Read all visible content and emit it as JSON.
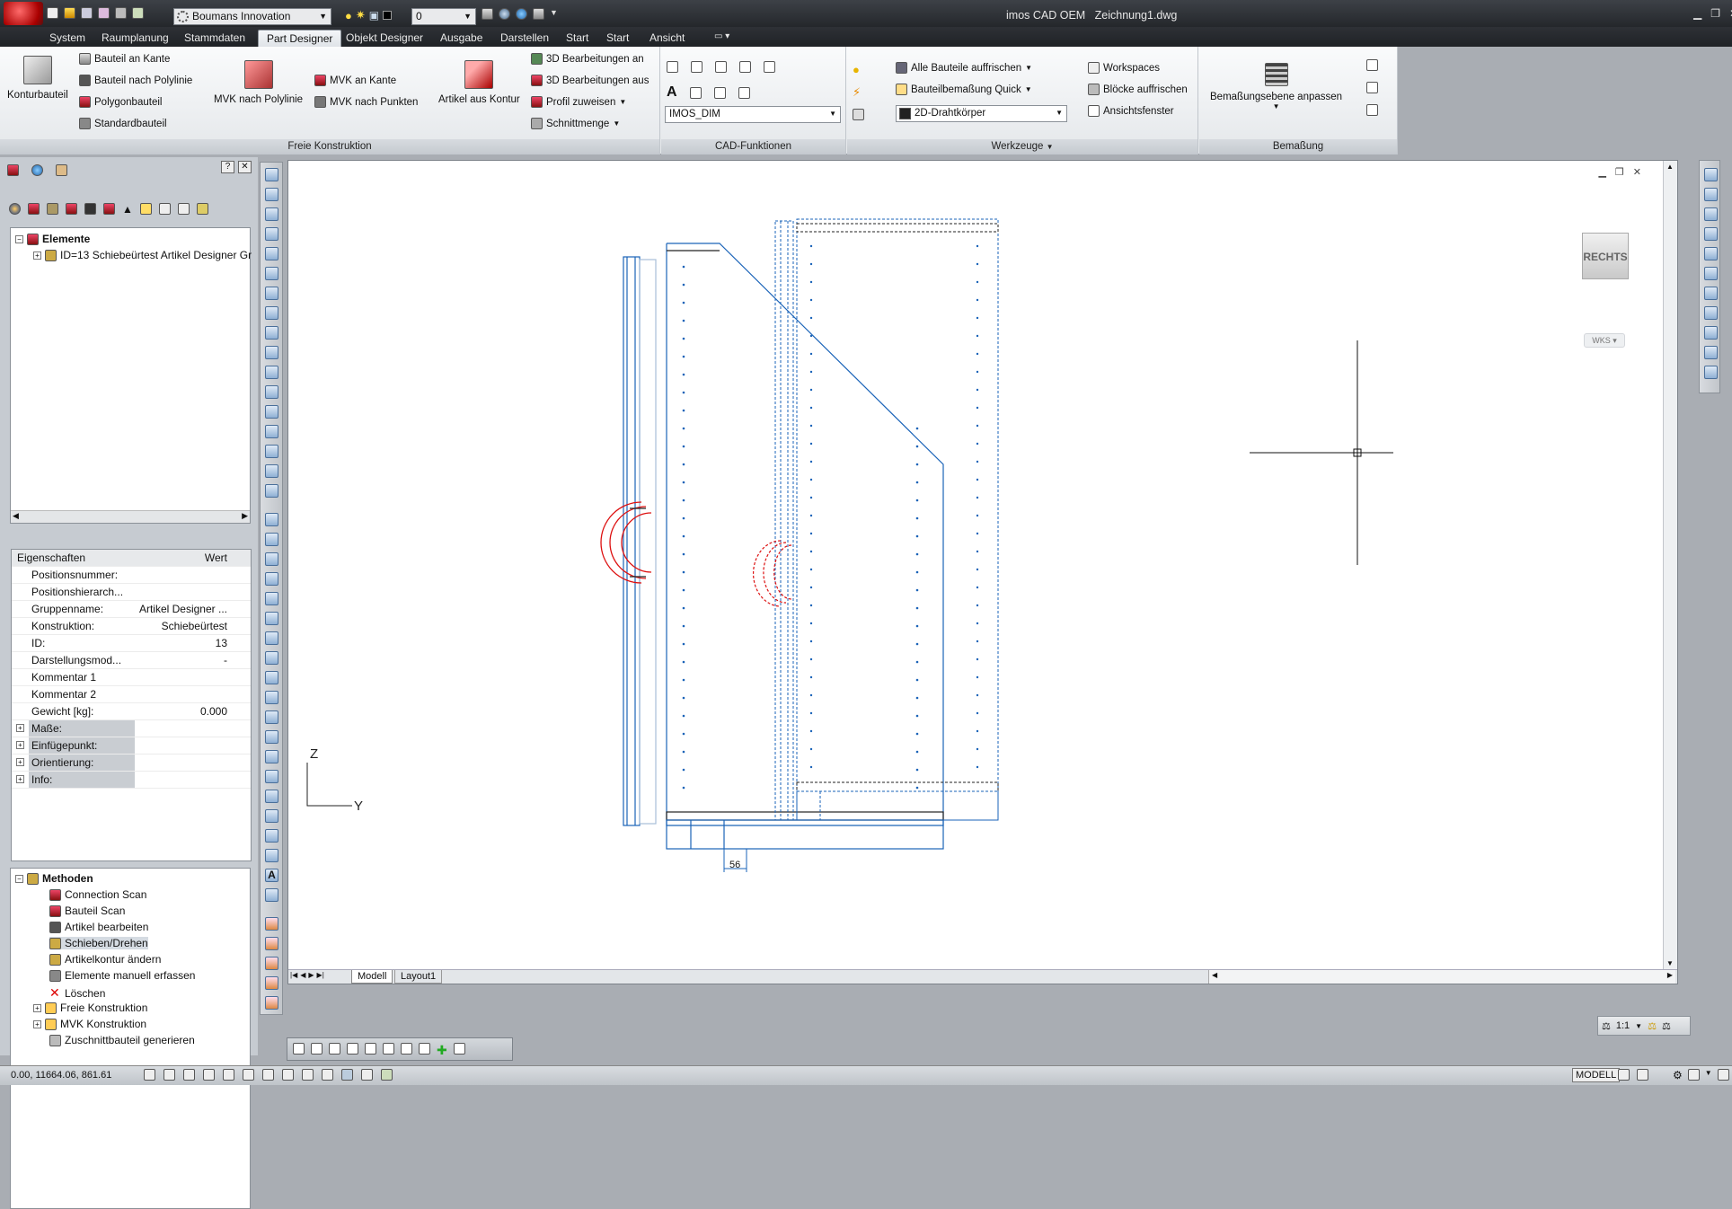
{
  "title_bar": {
    "workspace": "Boumans Innovation",
    "layer": "0",
    "app_title": "imos CAD OEM",
    "document": "Zeichnung1.dwg"
  },
  "menu_tabs": [
    {
      "label": "System"
    },
    {
      "label": "Raumplanung"
    },
    {
      "label": "Stammdaten"
    },
    {
      "label": "Part Designer",
      "active": true
    },
    {
      "label": "Objekt Designer"
    },
    {
      "label": "Ausgabe"
    },
    {
      "label": "Darstellen"
    },
    {
      "label": "Start"
    },
    {
      "label": "Start"
    },
    {
      "label": "Ansicht"
    }
  ],
  "ribbon": {
    "freie": {
      "title": "Freie Konstruktion",
      "konturbauteil": "Konturbauteil",
      "bauteil_kante": "Bauteil an Kante",
      "bauteil_polylinie": "Bauteil nach Polylinie",
      "polygonbauteil": "Polygonbauteil",
      "standardbauteil": "Standardbauteil",
      "mvk_polylinie": "MVK nach Polylinie",
      "mvk_kante": "MVK an Kante",
      "mvk_punkten": "MVK nach Punkten",
      "artikel_kontur": "Artikel aus Kontur",
      "bearb_an": "3D Bearbeitungen an",
      "bearb_aus": "3D Bearbeitungen aus",
      "profil": "Profil zuweisen",
      "schnittmenge": "Schnittmenge"
    },
    "cad": {
      "title": "CAD-Funktionen",
      "dimstyle": "IMOS_DIM"
    },
    "werkzeuge": {
      "title": "Werkzeuge",
      "alle_auffrischen": "Alle Bauteile auffrischen",
      "bemassung_quick": "Bauteilbemaßung Quick",
      "visual_style": "2D-Drahtkörper",
      "workspaces": "Workspaces",
      "bloecke": "Blöcke auffrischen",
      "ansichtsfenster": "Ansichtsfenster"
    },
    "bemassung": {
      "title": "Bemaßung",
      "ebene": "Bemaßungsebene anpassen"
    }
  },
  "elements_tree": {
    "root": "Elemente",
    "item": "ID=13 Schiebeürtest Artikel Designer Gr"
  },
  "properties": {
    "col_name": "Eigenschaften",
    "col_value": "Wert",
    "rows": [
      {
        "name": "Positionsnummer:",
        "value": ""
      },
      {
        "name": "Positionshierarch...",
        "value": ""
      },
      {
        "name": "Gruppenname:",
        "value": "Artikel Designer ..."
      },
      {
        "name": "Konstruktion:",
        "value": "Schiebeürtest"
      },
      {
        "name": "ID:",
        "value": "13"
      },
      {
        "name": "Darstellungsmod...",
        "value": "-"
      },
      {
        "name": "Kommentar 1",
        "value": ""
      },
      {
        "name": "Kommentar 2",
        "value": ""
      },
      {
        "name": "Gewicht [kg]:",
        "value": "0.000"
      }
    ],
    "groups": [
      "Maße:",
      "Einfügepunkt:",
      "Orientierung:",
      "Info:"
    ]
  },
  "methods_tree": {
    "root": "Methoden",
    "items": [
      "Connection Scan",
      "Bauteil Scan",
      "Artikel bearbeiten",
      "Schieben/Drehen",
      "Artikelkontur ändern",
      "Elemente manuell erfassen",
      "Löschen",
      "Freie Konstruktion",
      "MVK Konstruktion",
      "Zuschnittbauteil generieren"
    ]
  },
  "drawing": {
    "viewcube_label": "RECHTS",
    "ucs_label": "WKS",
    "dimension": "56",
    "axis_x": "Y",
    "axis_y": "Z",
    "layout_tabs": [
      "Modell",
      "Layout1"
    ]
  },
  "status_bar": {
    "coordinates": "0.00, 11664.06, 861.61",
    "scale": "1:1",
    "mode": "MODELL"
  }
}
